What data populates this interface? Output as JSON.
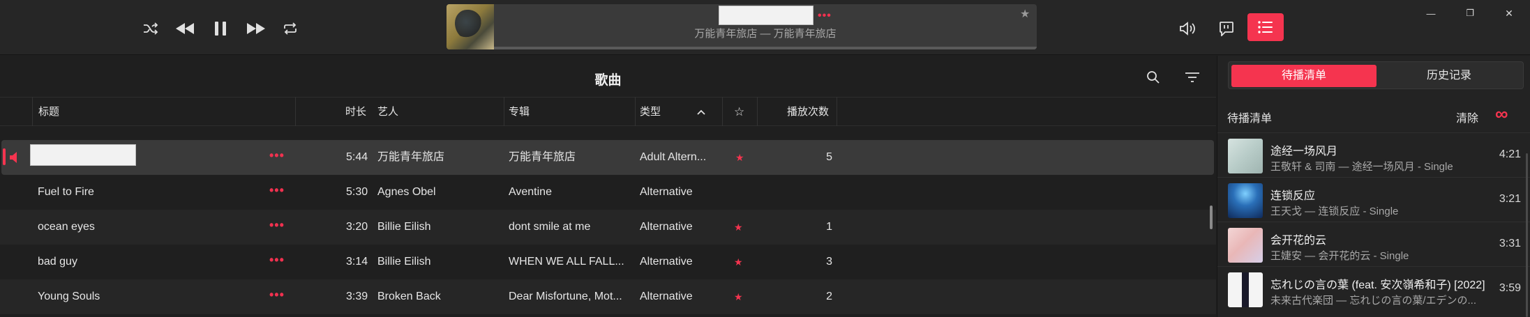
{
  "colors": {
    "accent": "#f5344f",
    "bg": "#1f1f1f",
    "row_alt": "#262626",
    "row_active": "#3a3a3a"
  },
  "player": {
    "controls": [
      "shuffle-icon",
      "previous-icon",
      "pause-icon",
      "next-icon",
      "repeat-icon"
    ],
    "now_playing": {
      "title": "",
      "more": "•••",
      "star": "★",
      "subtitle": "万能青年旅店 — 万能青年旅店",
      "progress": 0.0
    },
    "right_icons": [
      "volume-icon",
      "lyrics-icon",
      "queue-list-icon"
    ]
  },
  "window": {
    "minimize": "—",
    "maximize": "❐",
    "close": "✕"
  },
  "songs": {
    "title": "歌曲",
    "columns": {
      "title": "标题",
      "duration": "时长",
      "artist": "艺人",
      "album": "专辑",
      "genre": "类型",
      "favorite": "☆",
      "plays": "播放次数"
    },
    "rows": [
      {
        "title": "",
        "duration": "5:44",
        "artist": "万能青年旅店",
        "album": "万能青年旅店",
        "genre": "Adult Altern...",
        "favorite": "★",
        "plays": "5",
        "playing": true
      },
      {
        "title": "Fuel to Fire",
        "duration": "5:30",
        "artist": "Agnes Obel",
        "album": "Aventine",
        "genre": "Alternative",
        "favorite": "",
        "plays": ""
      },
      {
        "title": "ocean eyes",
        "duration": "3:20",
        "artist": "Billie Eilish",
        "album": "dont smile at me",
        "genre": "Alternative",
        "favorite": "★",
        "plays": "1"
      },
      {
        "title": "bad guy",
        "duration": "3:14",
        "artist": "Billie Eilish",
        "album": "WHEN WE ALL FALL...",
        "genre": "Alternative",
        "favorite": "★",
        "plays": "3"
      },
      {
        "title": "Young Souls",
        "duration": "3:39",
        "artist": "Broken Back",
        "album": "Dear Misfortune, Mot...",
        "genre": "Alternative",
        "favorite": "★",
        "plays": "2"
      }
    ],
    "row_more": "•••"
  },
  "queue": {
    "tabs": [
      "待播清单",
      "历史记录"
    ],
    "active_tab": 0,
    "label": "待播清单",
    "clear": "清除",
    "infinite": "∞",
    "items": [
      {
        "title": "途经一场风月",
        "subtitle": "王敬轩 & 司南 — 途经一场风月 - Single",
        "duration": "4:21"
      },
      {
        "title": "连锁反应",
        "subtitle": "王天戈 — 连锁反应 - Single",
        "duration": "3:21"
      },
      {
        "title": "会开花的云",
        "subtitle": "王婕安 — 会开花的云 - Single",
        "duration": "3:31"
      },
      {
        "title": "忘れじの言の葉 (feat. 安次嶺希和子) [2022]",
        "subtitle": "未来古代楽団 — 忘れじの言の葉/エデンの...",
        "duration": "3:59"
      }
    ]
  }
}
